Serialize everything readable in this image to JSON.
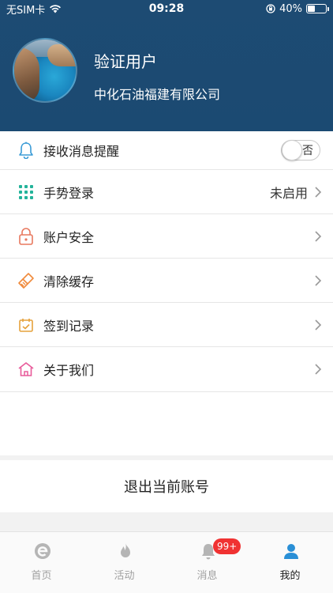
{
  "status_bar": {
    "carrier": "无SIM卡",
    "time": "09:28",
    "battery_text": "40%",
    "battery_level": 0.4
  },
  "profile": {
    "name": "验证用户",
    "company": "中化石油福建有限公司"
  },
  "menu": {
    "notify_label": "接收消息提醒",
    "notify_toggle_text": "否",
    "gesture_label": "手势登录",
    "gesture_value": "未启用",
    "security_label": "账户安全",
    "cache_label": "清除缓存",
    "checkin_label": "签到记录",
    "about_label": "关于我们"
  },
  "logout_label": "退出当前账号",
  "tabbar": {
    "home": "首页",
    "activity": "活动",
    "messages": "消息",
    "messages_badge": "99+",
    "mine": "我的"
  },
  "colors": {
    "header_bg": "#1b4a72",
    "badge": "#f03232",
    "active_tab_icon": "#2a8fd6"
  }
}
